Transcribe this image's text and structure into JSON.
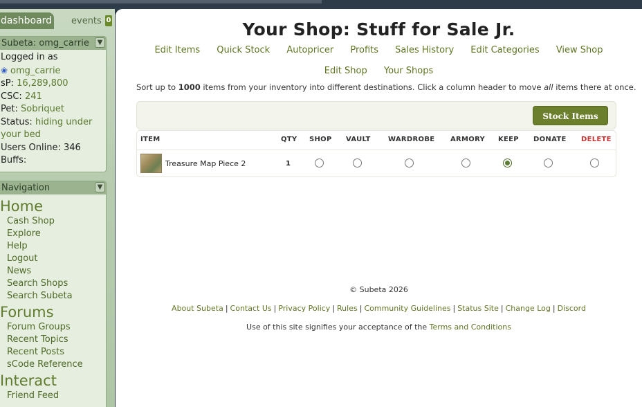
{
  "sidebar": {
    "tabs": {
      "dashboard": "dashboard",
      "events": "events",
      "events_count": "0"
    },
    "user_panel": {
      "header": "Subeta: omg_carrie",
      "logged_in_label": "Logged in as",
      "username": "omg_carrie",
      "sp_label": "sP:",
      "sp_value": "16,289,800",
      "csc_label": "CSC:",
      "csc_value": "241",
      "pet_label": "Pet:",
      "pet_value": "Sobriquet",
      "status_label": "Status:",
      "status_value_line1": "hiding under",
      "status_value_line2": "your bed",
      "users_online_label": "Users Online:",
      "users_online_value": "346",
      "buffs_label": "Buffs:"
    },
    "nav": {
      "header": "Navigation",
      "home": "Home",
      "home_items": [
        "Cash Shop",
        "Explore",
        "Help",
        "Logout",
        "News",
        "Search Shops",
        "Search Subeta"
      ],
      "forums": "Forums",
      "forums_items": [
        "Forum Groups",
        "Recent Topics",
        "Recent Posts",
        "sCode Reference"
      ],
      "interact": "Interact",
      "interact_items": [
        "Friend Feed"
      ]
    }
  },
  "main": {
    "title": "Your Shop: Stuff for Sale Jr.",
    "links_row1": [
      "Edit Items",
      "Quick Stock",
      "Autopricer",
      "Profits",
      "Sales History",
      "Edit Categories",
      "View Shop"
    ],
    "links_row2": [
      "Edit Shop",
      "Your Shops"
    ],
    "info_prefix": "Sort up to ",
    "info_count": "1000",
    "info_middle": " items from your inventory into different destinations. Click a column header to move ",
    "info_em": "all",
    "info_suffix": " items there at once.",
    "stock_button": "Stock Items",
    "table": {
      "headers": [
        "ITEM",
        "QTY",
        "SHOP",
        "VAULT",
        "WARDROBE",
        "ARMORY",
        "KEEP",
        "DONATE",
        "DELETE"
      ],
      "rows": [
        {
          "item": "Treasure Map Piece 2",
          "qty": "1",
          "selected": "KEEP"
        }
      ]
    }
  },
  "footer": {
    "copyright": "© Subeta 2026",
    "links": [
      "About Subeta",
      "Contact Us",
      "Privacy Policy",
      "Rules",
      "Community Guidelines",
      "Status Site",
      "Change Log",
      "Discord"
    ],
    "terms_prefix": "Use of this site signifies your acceptance of the ",
    "terms_link": "Terms and Conditions"
  },
  "colors": {
    "accent": "#5f7424",
    "button": "#6b7f2c",
    "delete": "#c43232"
  },
  "icons": {
    "chevron": "chevron-down-icon",
    "paw": "paw-icon",
    "item_thumb": "treasure-map-thumbnail"
  }
}
